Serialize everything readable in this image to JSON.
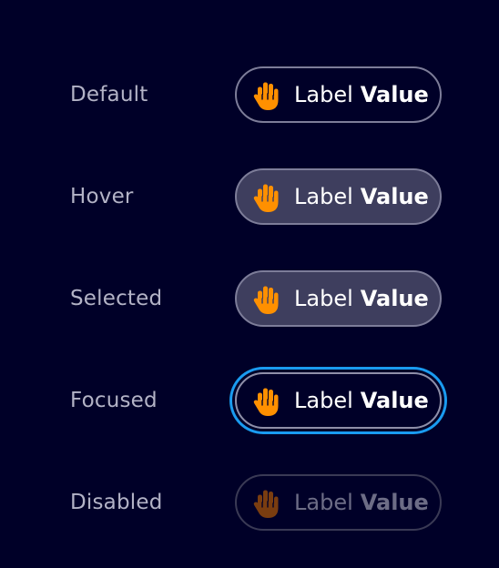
{
  "colors": {
    "background": "#000028",
    "state_label": "#b3b3c6",
    "hand_icon": "#ff9000",
    "hand_icon_disabled": "#7a3d10",
    "focus_ring": "#1a9bf0"
  },
  "states": [
    {
      "name": "Default",
      "chip_label": "Label",
      "chip_value": "Value",
      "icon": "hand-stop-icon"
    },
    {
      "name": "Hover",
      "chip_label": "Label",
      "chip_value": "Value",
      "icon": "hand-stop-icon"
    },
    {
      "name": "Selected",
      "chip_label": "Label",
      "chip_value": "Value",
      "icon": "hand-stop-icon"
    },
    {
      "name": "Focused",
      "chip_label": "Label",
      "chip_value": "Value",
      "icon": "hand-stop-icon"
    },
    {
      "name": "Disabled",
      "chip_label": "Label",
      "chip_value": "Value",
      "icon": "hand-stop-icon"
    }
  ]
}
